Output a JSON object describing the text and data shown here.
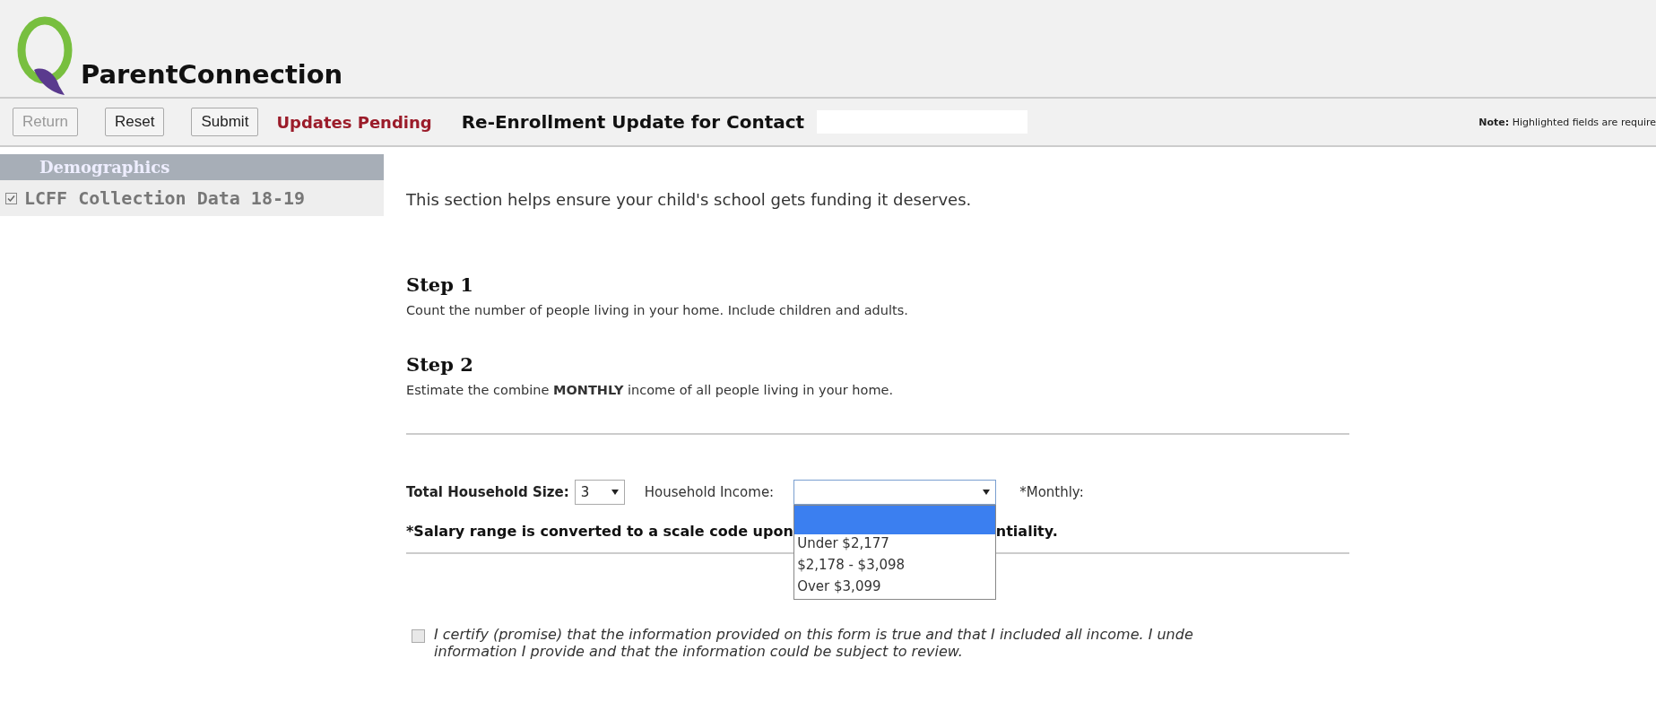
{
  "header": {
    "logo_text": "ParentConnection"
  },
  "toolbar": {
    "buttons": [
      {
        "label": "Return",
        "disabled": true
      },
      {
        "label": "Reset",
        "disabled": false
      },
      {
        "label": "Submit",
        "disabled": false
      }
    ],
    "status": "Updates Pending",
    "title": "Re-Enrollment Update for Contact",
    "note": "**Note:** Highlighted fields are require"
  },
  "sidebar": {
    "heading": "Demographics",
    "items": [
      {
        "label": "LCFF Collection Data 18-19",
        "checked": true
      }
    ]
  },
  "content": {
    "intro": "This section helps ensure your child's school gets funding it deserves.",
    "steps": [
      {
        "title": "Step 1",
        "text": "Count the number of people living in your home. Include children and adults."
      },
      {
        "title": "Step 2",
        "text": "Estimate the combine **MONTHLY** income of all people living in your home."
      }
    ],
    "household_size": {
      "label": "Total Household Size:",
      "value": "3"
    },
    "household_income": {
      "label": "Household Income:",
      "expanded": true,
      "blank_option_selected": true,
      "options": [
        {
          "label": "Under $2,177",
          "selected": false
        },
        {
          "label": "$2,178 - $3,098",
          "selected": false
        },
        {
          "label": "Over $3,099",
          "selected": false
        }
      ]
    },
    "monthly_label": "*Monthly:",
    "salary_note": [
      "*Salary range is converted to a scale code upon",
      "ntiality."
    ],
    "certify": {
      "checked": false,
      "lines": [
        "I certify (promise) that the information provided on this form is true and that I included all income.  I unde",
        "information I provide and that the information could be subject to review."
      ]
    }
  }
}
